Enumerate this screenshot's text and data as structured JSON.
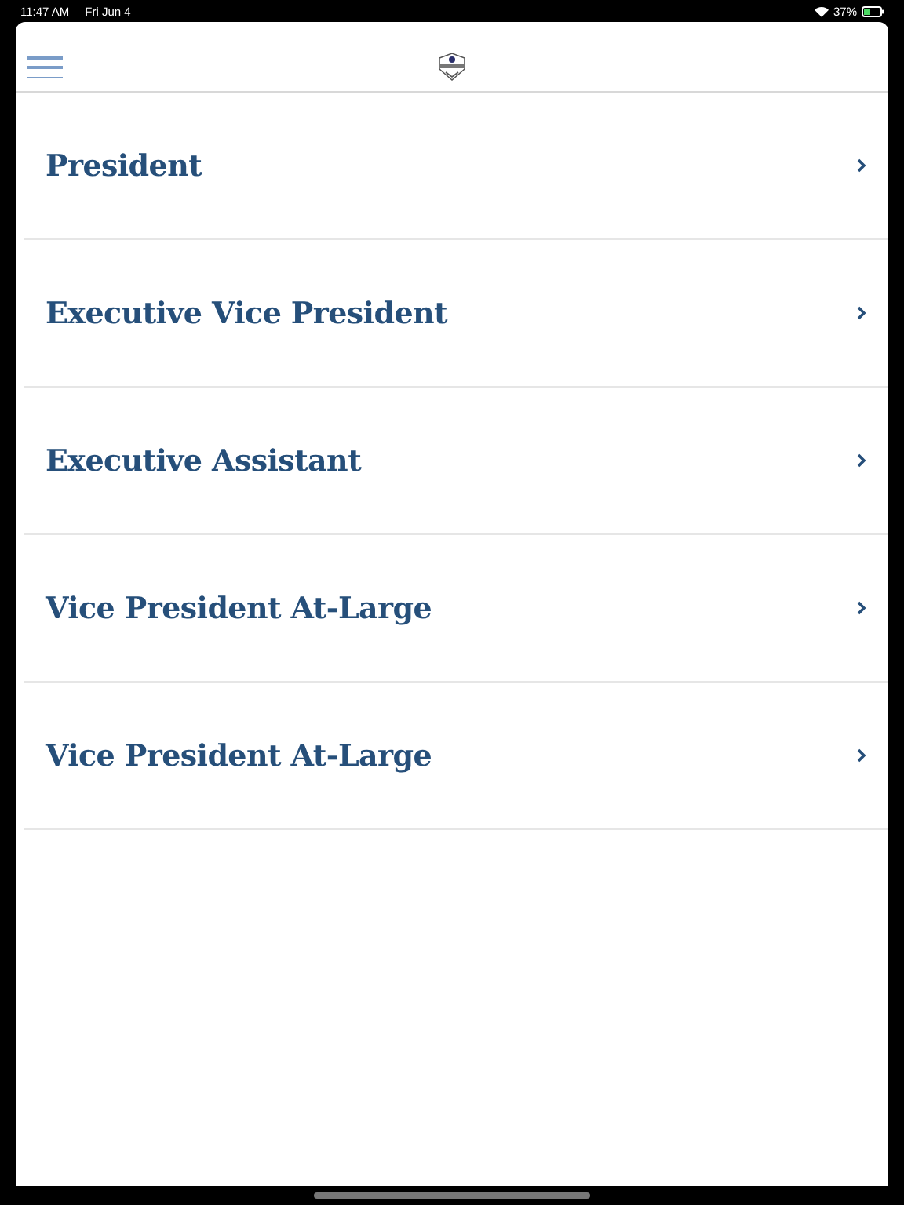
{
  "status_bar": {
    "time": "11:47 AM",
    "date": "Fri Jun 4",
    "battery": "37%"
  },
  "menu_items": [
    {
      "label": "President"
    },
    {
      "label": "Executive Vice President"
    },
    {
      "label": "Executive Assistant"
    },
    {
      "label": "Vice President At-Large"
    },
    {
      "label": "Vice President At-Large"
    }
  ]
}
